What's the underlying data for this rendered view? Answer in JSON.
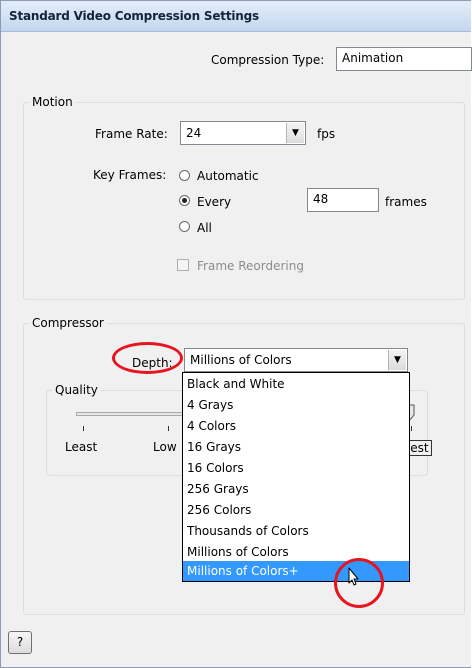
{
  "window": {
    "title": "Standard Video Compression Settings"
  },
  "compression": {
    "label": "Compression Type:",
    "value": "Animation"
  },
  "motion": {
    "group_label": "Motion",
    "frame_rate_label": "Frame Rate:",
    "frame_rate_value": "24",
    "fps_label": "fps",
    "key_frames_label": "Key Frames:",
    "automatic_label": "Automatic",
    "every_label": "Every",
    "every_value": "48",
    "frames_label": "frames",
    "all_label": "All",
    "frame_reordering_label": "Frame Reordering",
    "selected_key_frames": "Every"
  },
  "compressor": {
    "group_label": "Compressor",
    "depth_label": "Depth:",
    "depth_value": "Millions of Colors",
    "quality_group_label": "Quality",
    "quality_ticks": [
      "Least",
      "Low",
      "Best"
    ],
    "depth_options": [
      "Black and White",
      "4 Grays",
      "4 Colors",
      "16 Grays",
      "16 Colors",
      "256 Grays",
      "256 Colors",
      "Thousands of Colors",
      "Millions of Colors",
      "Millions of Colors+"
    ],
    "highlighted_option": "Millions of Colors+"
  },
  "footer": {
    "help_label": "?"
  },
  "colors": {
    "annotation": "#e5161f",
    "selection": "#3399ff"
  },
  "icons": {
    "dropdown_arrow": "chevron-down-icon",
    "cursor": "mouse-pointer-icon"
  }
}
